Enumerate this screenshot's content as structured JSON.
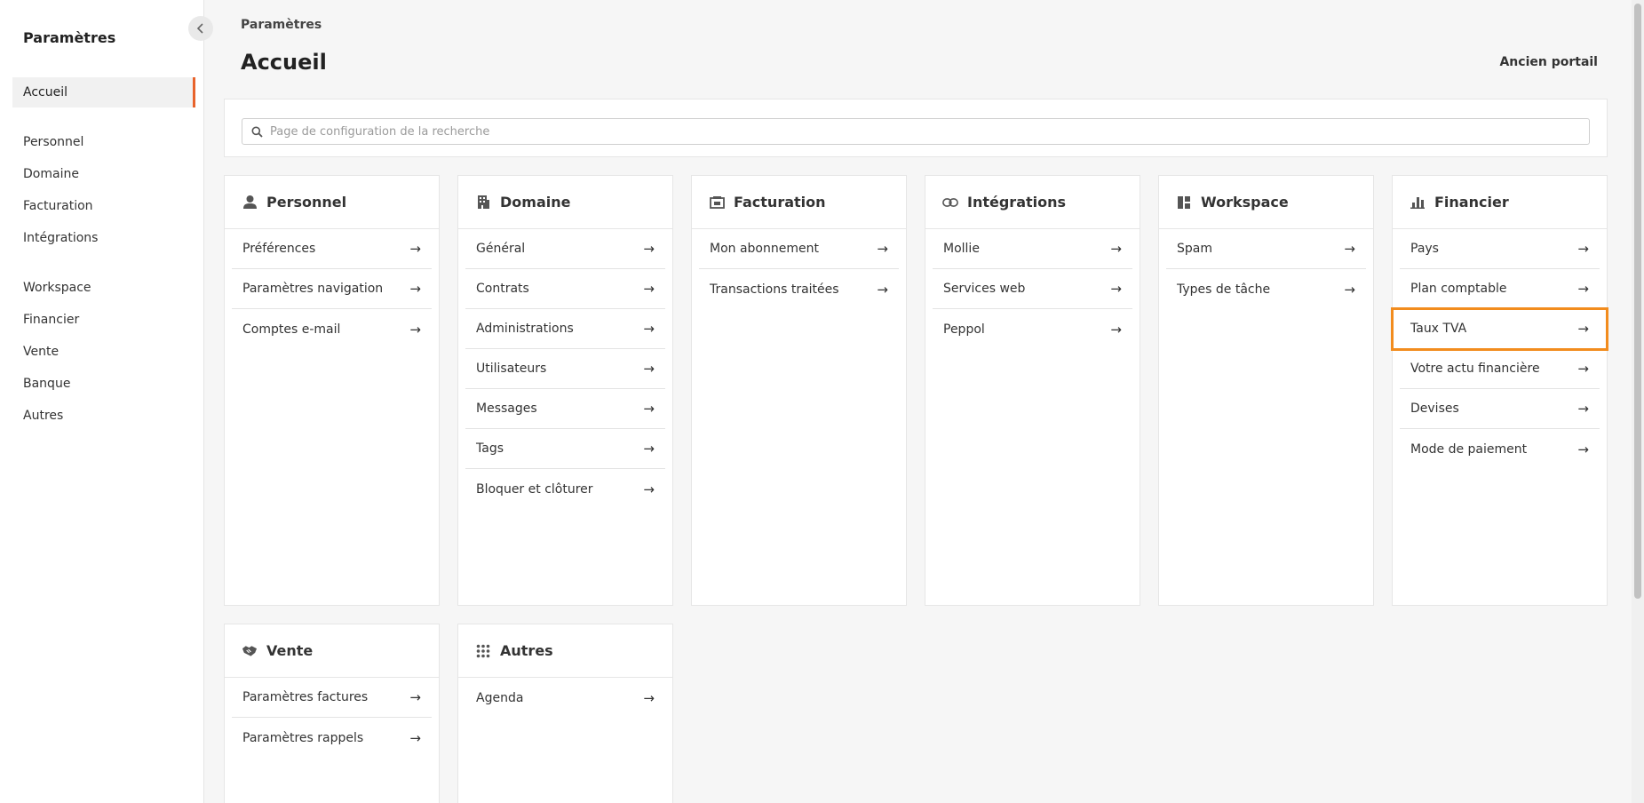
{
  "sidebar": {
    "title": "Paramètres",
    "items": [
      {
        "label": "Accueil",
        "active": true
      },
      {
        "label": "Personnel"
      },
      {
        "label": "Domaine"
      },
      {
        "label": "Facturation"
      },
      {
        "label": "Intégrations"
      },
      {
        "label": "Workspace"
      },
      {
        "label": "Financier"
      },
      {
        "label": "Vente"
      },
      {
        "label": "Banque"
      },
      {
        "label": "Autres"
      }
    ]
  },
  "header": {
    "breadcrumb": "Paramètres",
    "title": "Accueil",
    "old_portal": "Ancien portail"
  },
  "search": {
    "placeholder": "Page de configuration de la recherche",
    "value": ""
  },
  "cards": [
    {
      "title": "Personnel",
      "icon": "person-icon",
      "items": [
        "Préférences",
        "Paramètres navigation",
        "Comptes e-mail"
      ]
    },
    {
      "title": "Domaine",
      "icon": "building-icon",
      "items": [
        "Général",
        "Contrats",
        "Administrations",
        "Utilisateurs",
        "Messages",
        "Tags",
        "Bloquer et clôturer"
      ]
    },
    {
      "title": "Facturation",
      "icon": "invoice-icon",
      "items": [
        "Mon abonnement",
        "Transactions traitées"
      ]
    },
    {
      "title": "Intégrations",
      "icon": "link-icon",
      "items": [
        "Mollie",
        "Services web",
        "Peppol"
      ]
    },
    {
      "title": "Workspace",
      "icon": "workspace-icon",
      "items": [
        "Spam",
        "Types de tâche"
      ]
    },
    {
      "title": "Financier",
      "icon": "bar-chart-icon",
      "items": [
        "Pays",
        "Plan comptable",
        "Taux TVA",
        "Votre actu financière",
        "Devises",
        "Mode de paiement"
      ]
    },
    {
      "title": "Vente",
      "icon": "handshake-icon",
      "items": [
        "Paramètres factures",
        "Paramètres rappels"
      ]
    },
    {
      "title": "Autres",
      "icon": "grid-dots-icon",
      "items": [
        "Agenda"
      ]
    }
  ],
  "colors": {
    "accent": "#e8632b",
    "highlight": "#f28c1e"
  }
}
